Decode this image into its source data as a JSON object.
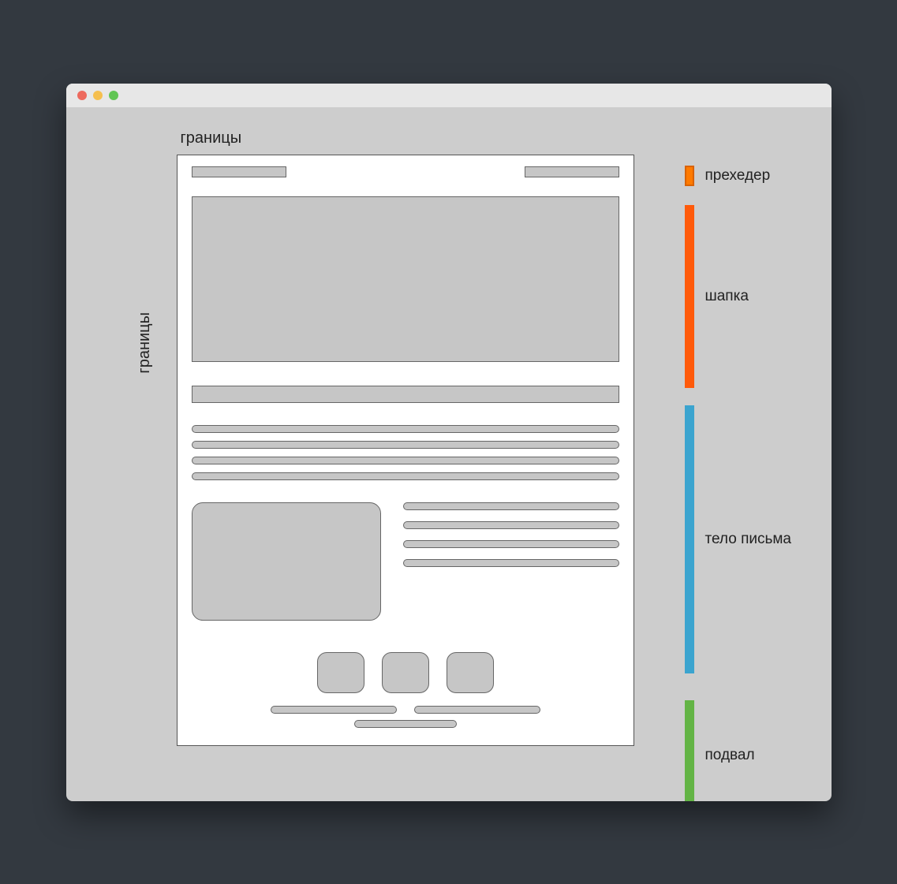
{
  "labels": {
    "top": "границы",
    "left": "границы"
  },
  "legend": {
    "preheader": "прехедер",
    "header": "шапка",
    "body": "тело письма",
    "footer": "подвал"
  },
  "colors": {
    "preheader": "#ff7a00",
    "header": "#ff5a0a",
    "body": "#3ba4cf",
    "footer": "#63b445"
  }
}
